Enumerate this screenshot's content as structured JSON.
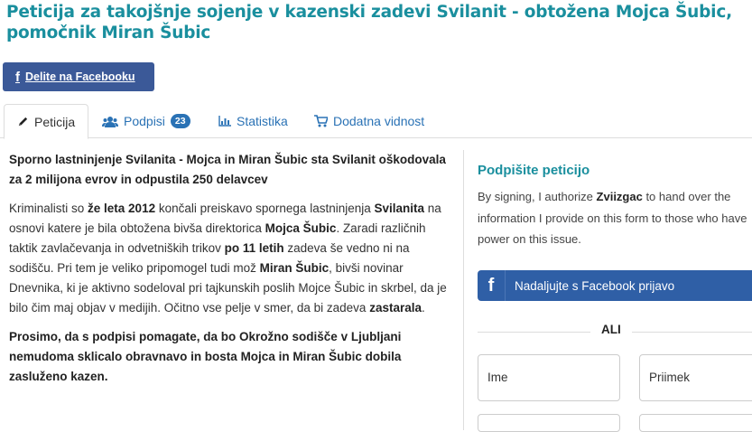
{
  "page": {
    "title": "Peticija za takojšnje sojenje v kazenski zadevi Svilanit - obtožena Mojca Šubic, pomočnik Miran Šubic"
  },
  "share": {
    "label": "Delite na Facebooku"
  },
  "tabs": [
    {
      "label": "Peticija",
      "icon": "pencil-icon",
      "active": true
    },
    {
      "label": "Podpisi",
      "icon": "users-icon",
      "badge": "23"
    },
    {
      "label": "Statistika",
      "icon": "bar-chart-icon"
    },
    {
      "label": "Dodatna vidnost",
      "icon": "cart-icon"
    }
  ],
  "content": {
    "lead": "Sporno lastninjenje Svilanita - Mojca in Miran Šubic sta Svilanit oškodovala za 2 milijona evrov in odpustila 250 delavcev",
    "p1": {
      "t1": "Kriminalisti so ",
      "b1": "že leta 2012",
      "t2": " končali preiskavo spornega lastninjenja ",
      "b2": "Svilanita",
      "t3": " na osnovi katere je bila obtožena bivša direktorica ",
      "b3": "Mojca Šubic",
      "t4": ". Zaradi različnih taktik zavlačevanja in odvetniških trikov ",
      "b4": "po 11 letih",
      "t5": " zadeva še vedno ni na sodišču. Pri tem je veliko pripomogel tudi mož ",
      "b5": "Miran Šubic",
      "t6": ", bivši novinar Dnevnika, ki je aktivno sodeloval pri tajkunskih poslih Mojce Šubic in skrbel, da je bilo čim maj objav v medijih. Očitno vse pelje v smer, da bi zadeva ",
      "b6": "zastarala",
      "t7": "."
    },
    "bottom": "Prosimo, da s podpisi pomagate, da bo Okrožno sodišče v Ljubljani nemudoma  sklicalo obravnavo in bosta Mojca in Miran Šubic dobila zasluženo kazen."
  },
  "sidebar": {
    "title": "Podpišite peticijo",
    "text_before": "By signing, I authorize ",
    "text_bold": "Zviizgac",
    "text_after": " to hand over the information I provide on this form to those who have power on this issue.",
    "fb_button": "Nadaljujte s Facebook prijavo",
    "or_label": "ALI",
    "first_name_placeholder": "Ime",
    "last_name_placeholder": "Priimek"
  },
  "colors": {
    "accent": "#1a8f9e",
    "facebook": "#3b5998",
    "link": "#2a72b5"
  }
}
